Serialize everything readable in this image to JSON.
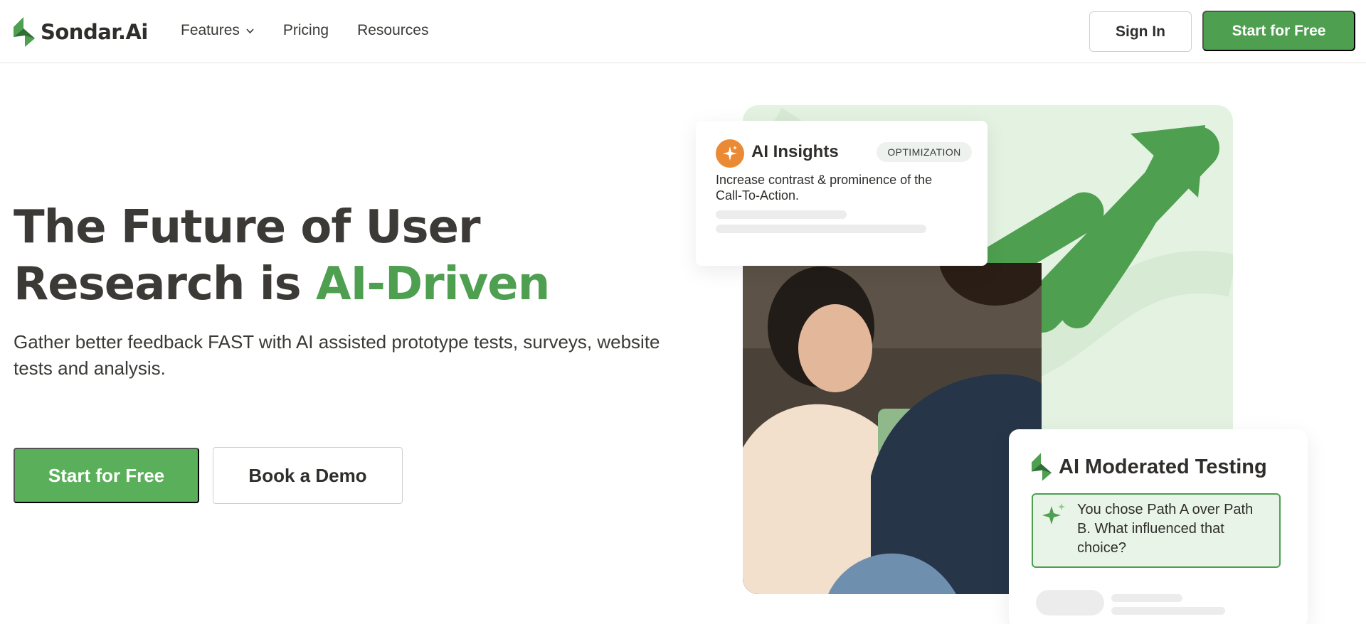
{
  "nav": {
    "logo_text": "Sondar.Ai",
    "links": [
      {
        "label": "Features",
        "has_dropdown": true
      },
      {
        "label": "Pricing",
        "has_dropdown": false
      },
      {
        "label": "Resources",
        "has_dropdown": false
      }
    ],
    "sign_in_label": "Sign In",
    "start_label": "Start for Free"
  },
  "hero": {
    "title_line1": "The Future of User",
    "title_line2_prefix": "Research is ",
    "title_line2_accent": "AI-Driven",
    "subtitle": "Gather better feedback FAST with AI assisted prototype tests, surveys, website tests and analysis.",
    "primary_cta": "Start for Free",
    "secondary_cta": "Book a Demo"
  },
  "insights_card": {
    "title": "AI Insights",
    "badge": "OPTIMIZATION",
    "text": "Increase contrast & prominence of the Call-To-Action.",
    "icon": "sparkle-icon"
  },
  "moderated_card": {
    "title": "AI Moderated Testing",
    "message": "You chose Path A over Path B. What influenced that choice?",
    "icon": "sparkle-icon"
  },
  "colors": {
    "brand_green": "#4e9f50",
    "cta_green": "#5aaf5a",
    "light_green": "#e4f2e2",
    "orange": "#ea8a34",
    "text_dark": "#3b3a36"
  }
}
